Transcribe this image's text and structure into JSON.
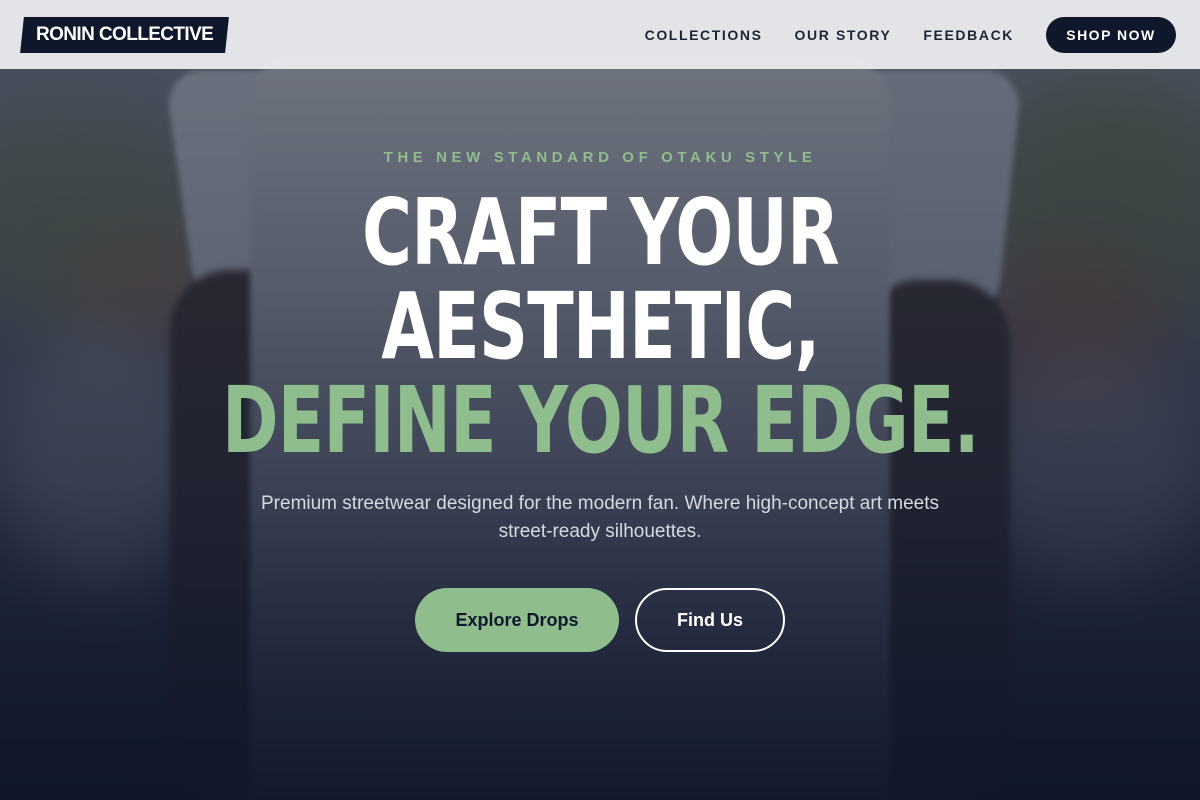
{
  "brand": {
    "name": "RONIN COLLECTIVE"
  },
  "nav": {
    "items": [
      {
        "label": "COLLECTIONS"
      },
      {
        "label": "OUR STORY"
      },
      {
        "label": "FEEDBACK"
      }
    ],
    "cta_label": "SHOP NOW"
  },
  "hero": {
    "eyebrow": "THE NEW STANDARD OF OTAKU STYLE",
    "headline_line1": "CRAFT YOUR",
    "headline_line2": "AESTHETIC,",
    "headline_line3": "DEFINE YOUR EDGE.",
    "subtitle": "Premium streetwear designed for the modern fan. Where high-concept art meets street-ready silhouettes.",
    "primary_button": "Explore Drops",
    "secondary_button": "Find Us"
  },
  "colors": {
    "accent_green": "#8fbd8e",
    "navy": "#0f172a",
    "header_bg": "#e8e9eb"
  }
}
